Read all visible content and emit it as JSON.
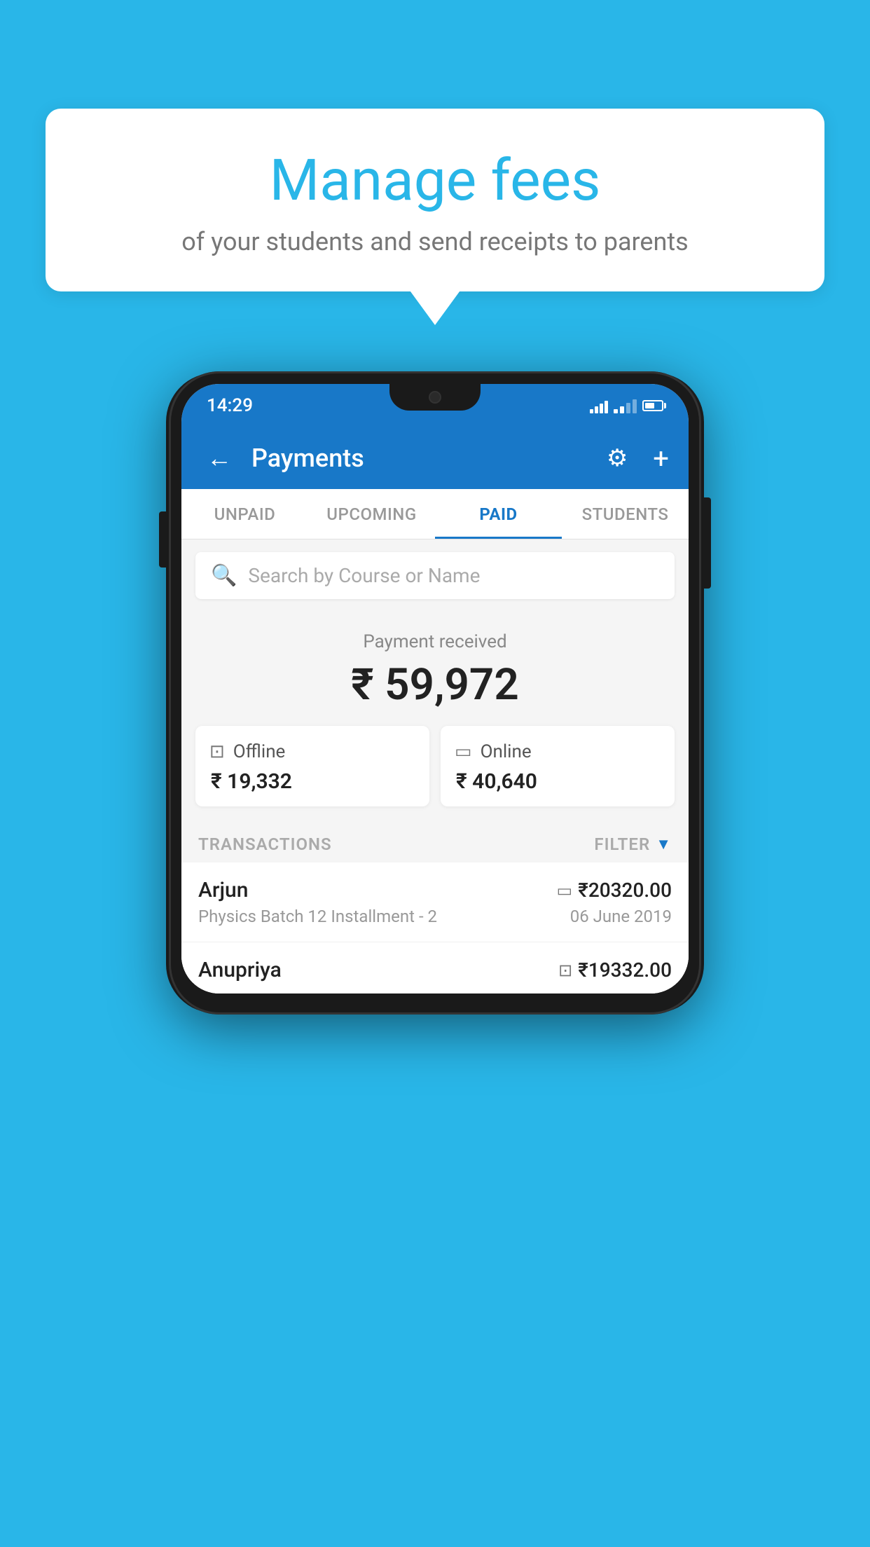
{
  "page": {
    "background_color": "#29b6e8"
  },
  "speech_bubble": {
    "title": "Manage fees",
    "subtitle": "of your students and send receipts to parents"
  },
  "status_bar": {
    "time": "14:29"
  },
  "app_header": {
    "title": "Payments",
    "back_label": "←",
    "plus_label": "+"
  },
  "tabs": [
    {
      "id": "unpaid",
      "label": "UNPAID",
      "active": false
    },
    {
      "id": "upcoming",
      "label": "UPCOMING",
      "active": false
    },
    {
      "id": "paid",
      "label": "PAID",
      "active": true
    },
    {
      "id": "students",
      "label": "STUDENTS",
      "active": false
    }
  ],
  "search": {
    "placeholder": "Search by Course or Name"
  },
  "payment_summary": {
    "label": "Payment received",
    "amount": "₹ 59,972"
  },
  "offline_card": {
    "label": "Offline",
    "amount": "₹ 19,332"
  },
  "online_card": {
    "label": "Online",
    "amount": "₹ 40,640"
  },
  "transactions_section": {
    "label": "TRANSACTIONS",
    "filter_label": "FILTER"
  },
  "transactions": [
    {
      "name": "Arjun",
      "description": "Physics Batch 12 Installment - 2",
      "amount": "₹20320.00",
      "date": "06 June 2019",
      "type": "online"
    },
    {
      "name": "Anupriya",
      "description": "",
      "amount": "₹19332.00",
      "date": "",
      "type": "offline"
    }
  ]
}
